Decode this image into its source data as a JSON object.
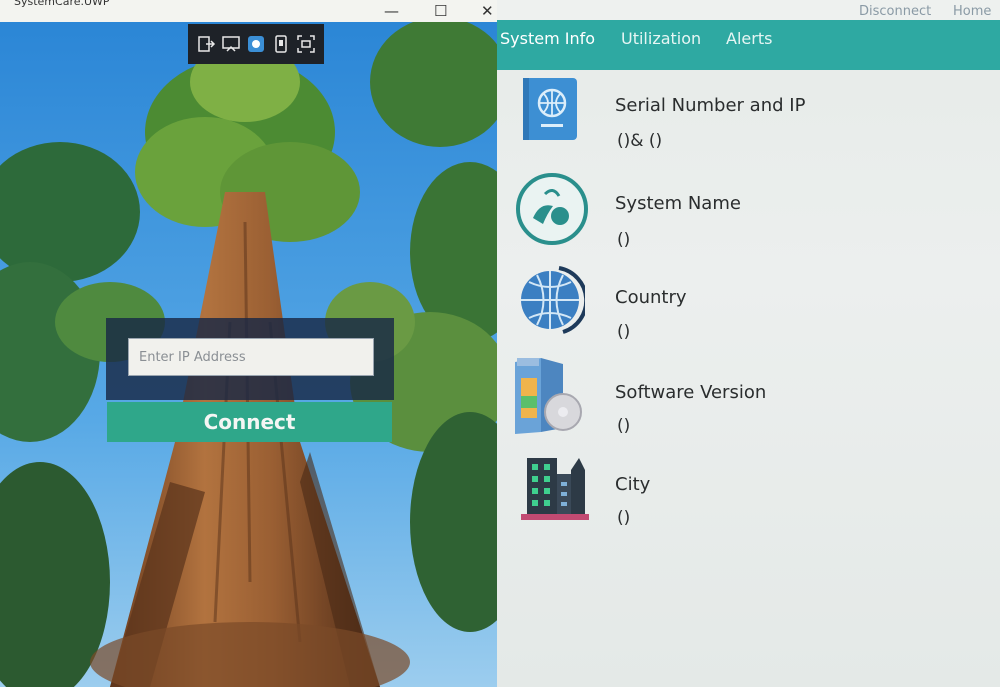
{
  "window": {
    "title": "SystemCare.UWP",
    "minimize_glyph": "—",
    "maximize_glyph": "☐",
    "close_glyph": "✕"
  },
  "toolbar": {
    "icons": [
      "exit-icon",
      "cast-icon",
      "record-icon",
      "phone-icon",
      "screenshot-icon"
    ]
  },
  "login": {
    "ip_placeholder": "Enter IP Address",
    "ip_value": "",
    "connect_label": "Connect"
  },
  "header": {
    "disconnect_label": "Disconnect",
    "home_label": "Home"
  },
  "tabs": [
    {
      "label": "System Info",
      "active": true
    },
    {
      "label": "Utilization",
      "active": false
    },
    {
      "label": "Alerts",
      "active": false
    }
  ],
  "info_items": [
    {
      "label": "Serial Number and IP",
      "value": "()& ()",
      "icon": "passport-icon"
    },
    {
      "label": "System Name",
      "value": "()",
      "icon": "baby-icon"
    },
    {
      "label": "Country",
      "value": "()",
      "icon": "globe-icon"
    },
    {
      "label": "Software Version",
      "value": "()",
      "icon": "software-box-icon"
    },
    {
      "label": "City",
      "value": "()",
      "icon": "city-icon"
    }
  ],
  "colors": {
    "accent": "#2ea9a2",
    "connect_button": "#2fa78a",
    "login_panel": "#192846"
  }
}
